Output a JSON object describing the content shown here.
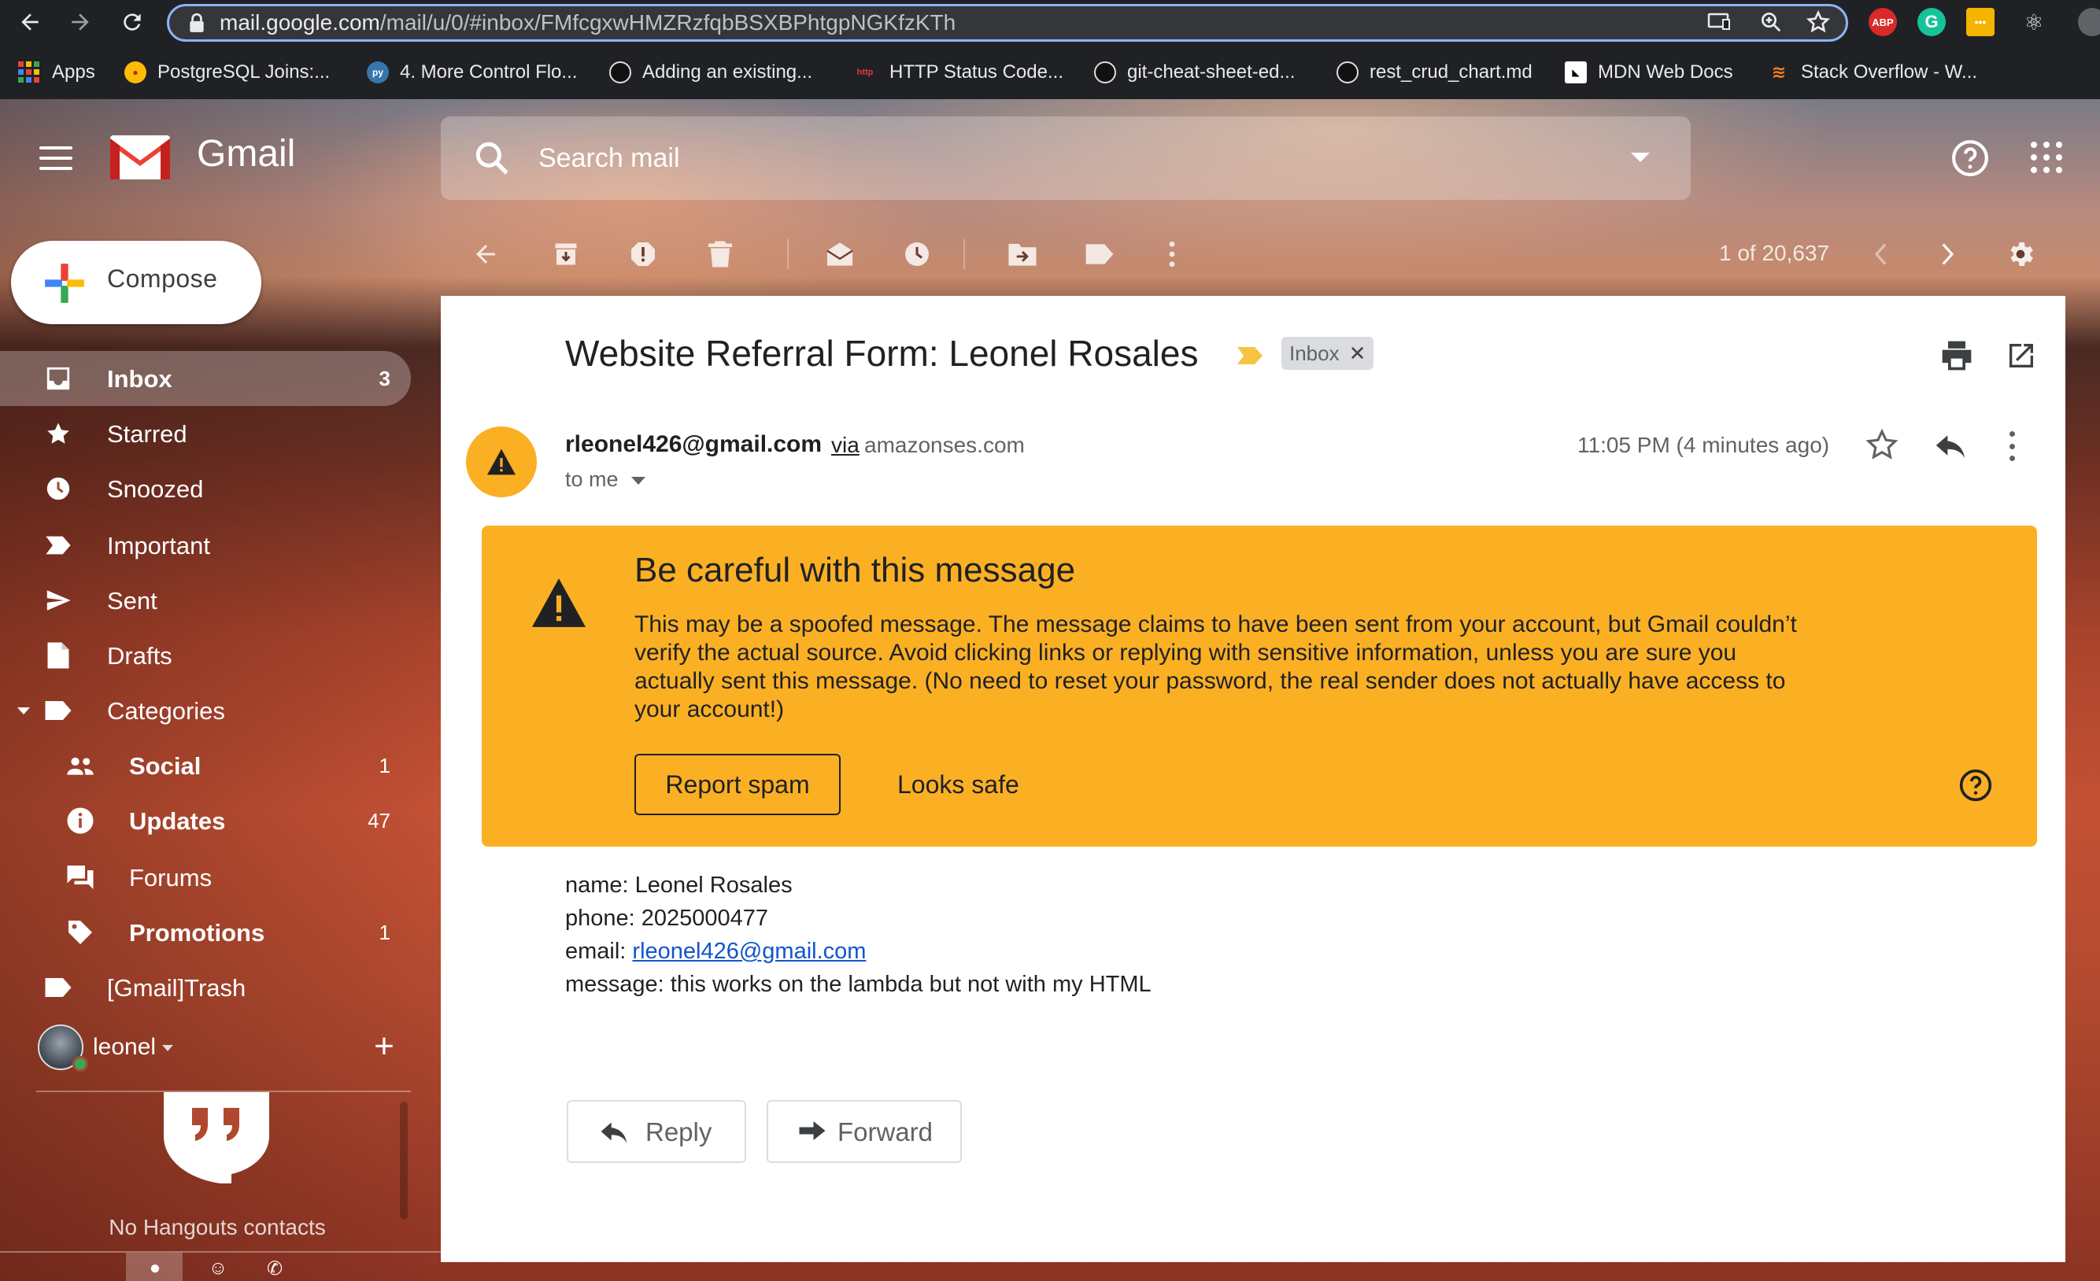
{
  "browser": {
    "url_host": "mail.google.com",
    "url_path": "/mail/u/0/#inbox/FMfcgxwHMZRzfqbBSXBPhtgpNGKfzKTh",
    "bookmarks": [
      {
        "label": "Apps"
      },
      {
        "label": "PostgreSQL Joins:..."
      },
      {
        "label": "4. More Control Flo..."
      },
      {
        "label": "Adding an existing..."
      },
      {
        "label": "HTTP Status Code..."
      },
      {
        "label": "git-cheat-sheet-ed..."
      },
      {
        "label": "rest_crud_chart.md"
      },
      {
        "label": "MDN Web Docs"
      },
      {
        "label": "Stack Overflow - W..."
      }
    ],
    "extensions": [
      "ABP",
      "G",
      "•••",
      "⚛"
    ]
  },
  "gmail": {
    "logo_text": "Gmail",
    "search_placeholder": "Search mail"
  },
  "sidebar": {
    "compose_label": "Compose",
    "items": [
      {
        "label": "Inbox",
        "count": "3"
      },
      {
        "label": "Starred",
        "count": ""
      },
      {
        "label": "Snoozed",
        "count": ""
      },
      {
        "label": "Important",
        "count": ""
      },
      {
        "label": "Sent",
        "count": ""
      },
      {
        "label": "Drafts",
        "count": ""
      },
      {
        "label": "Categories",
        "count": ""
      },
      {
        "label": "Social",
        "count": "1"
      },
      {
        "label": "Updates",
        "count": "47"
      },
      {
        "label": "Forums",
        "count": ""
      },
      {
        "label": "Promotions",
        "count": "1"
      },
      {
        "label": "[Gmail]Trash",
        "count": ""
      }
    ],
    "user_name": "leonel",
    "hangouts_empty": "No Hangouts contacts"
  },
  "toolbar": {
    "pager": "1 of 20,637"
  },
  "message": {
    "subject": "Website Referral Form: Leonel Rosales",
    "label_chip": "Inbox",
    "sender_email": "rleonel426@gmail.com",
    "via_text": "via",
    "via_host": "amazonses.com",
    "to_text": "to me",
    "time": "11:05 PM (4 minutes ago)",
    "warning": {
      "title": "Be careful with this message",
      "body": "This may be a spoofed message. The message claims to have been sent from your account, but Gmail couldn’t verify the actual source. Avoid clicking links or replying with sensitive information, unless you are sure you actually sent this message. (No need to reset your password, the real sender does not actually have access to your account!)",
      "report_label": "Report spam",
      "safe_label": "Looks safe"
    },
    "body": {
      "name_line": "name: Leonel Rosales",
      "phone_line": "phone: 2025000477",
      "email_prefix": "email: ",
      "email_link": "rleonel426@gmail.com",
      "message_line": "message: this works on the lambda but not with my HTML"
    },
    "reply_label": "Reply",
    "forward_label": "Forward"
  },
  "colors": {
    "warning_bg": "#fbb024",
    "link": "#1155cc",
    "gmail_red": "#ea4335"
  }
}
